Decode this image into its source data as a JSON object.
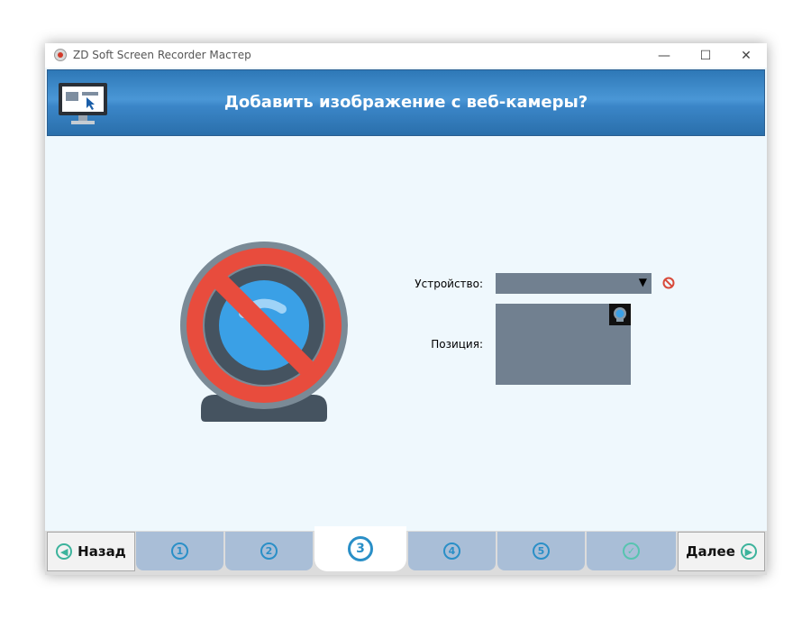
{
  "window": {
    "title": "ZD Soft Screen Recorder Мастер",
    "controls": {
      "minimize": "—",
      "maximize": "☐",
      "close": "✕"
    }
  },
  "header": {
    "title": "Добавить изображение с веб-камеры?"
  },
  "form": {
    "device_label": "Устройство:",
    "device_value": "",
    "position_label": "Позиция:"
  },
  "nav": {
    "back_label": "Назад",
    "next_label": "Далее",
    "steps": [
      "1",
      "2",
      "3",
      "4",
      "5",
      "✓"
    ],
    "active_step": "3"
  },
  "colors": {
    "header": "#3b86c8",
    "step_tab": "#a9bed7",
    "accent": "#3cb39c",
    "forbidden": "#e84c3d",
    "select_bg": "#718090"
  }
}
